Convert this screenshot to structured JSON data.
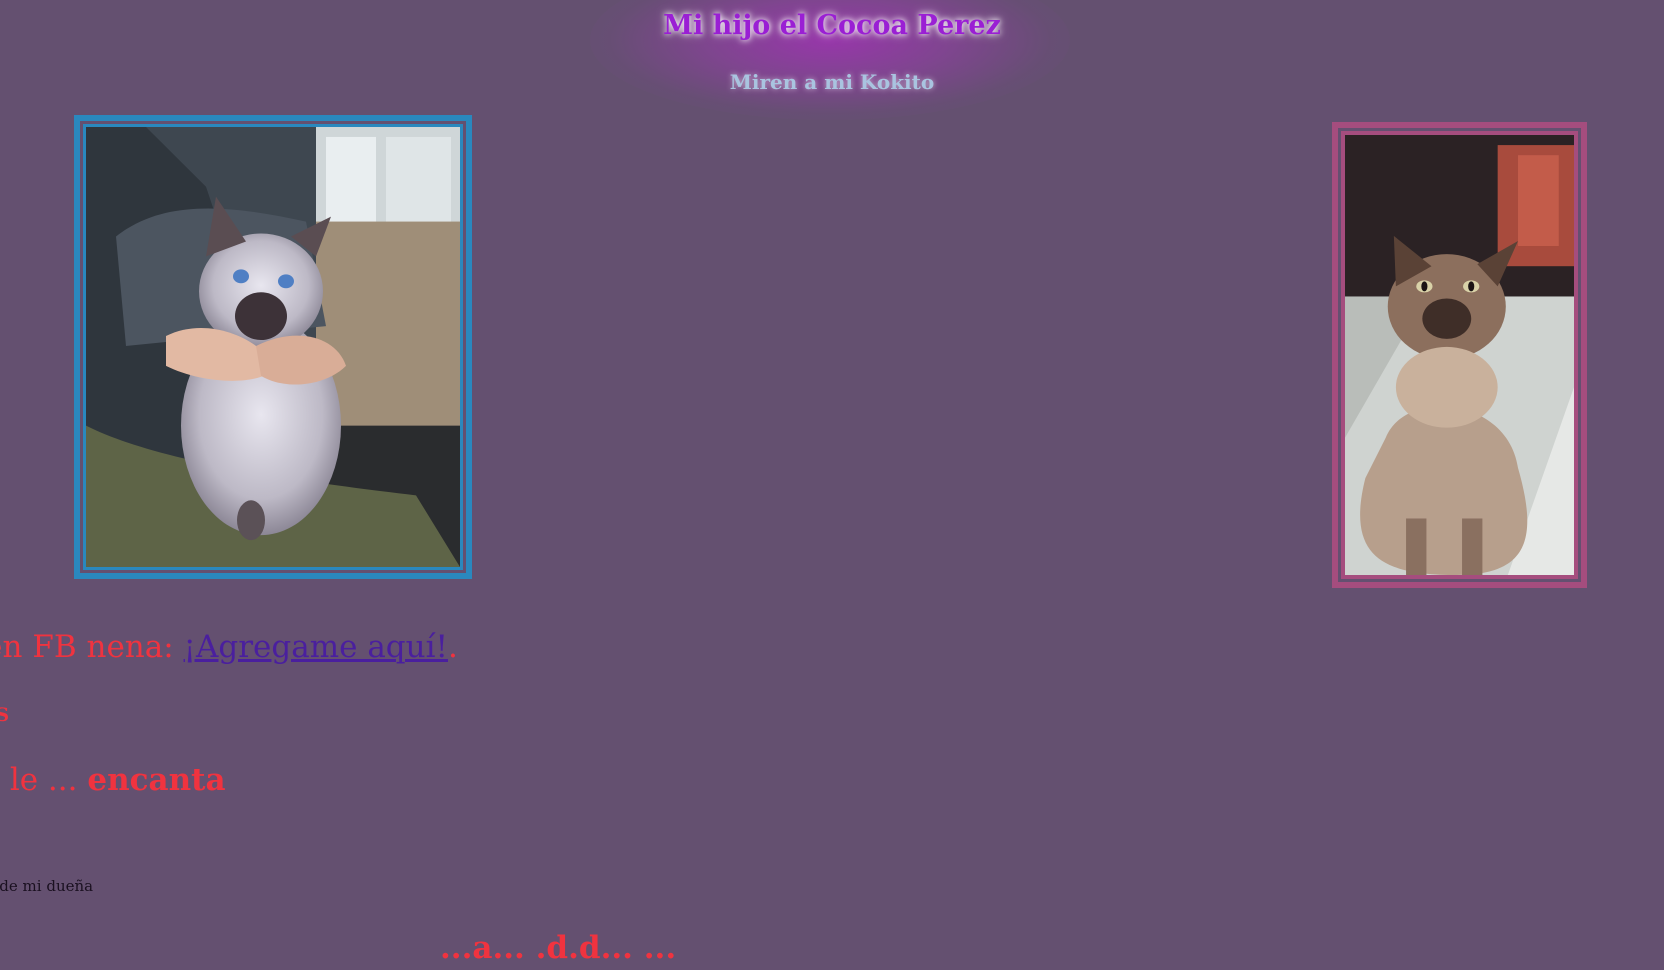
{
  "header": {
    "title": "Mi hijo el Cocoa Perez",
    "subtitle": "Miren a mi Kokito"
  },
  "photos": {
    "left_frame_color": "#2a88be",
    "right_frame_color": "#a54d7e"
  },
  "content": {
    "fb_prefix": "ne en FB nena: ",
    "fb_link_open": "¡",
    "fb_link_text": "Agregame aquí!",
    "fb_suffix": ".",
    "favoritos_heading": "RITOS",
    "encanta_prefix": "n le ... ",
    "encanta_bold": "encanta",
    "duena_text": "ne de mi dueña",
    "bottom_cut_text": "...a... .d.d... ..."
  },
  "colors": {
    "background": "#645070",
    "title": "#9a1fd4",
    "subtitle": "#a9c4e0",
    "red_text": "#f0333f",
    "link": "#4a1f9e"
  }
}
